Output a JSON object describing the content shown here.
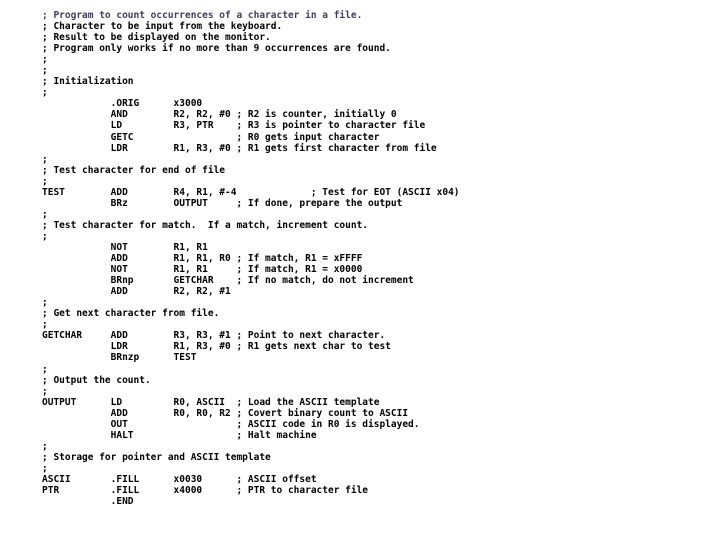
{
  "document": {
    "kind": "lc3-assembly-source-listing",
    "title": "Program to count occurrences of a character in a file.",
    "background_color": "#ffffff",
    "default_text_color": "#000000",
    "accent_text_color": "#3c3c64",
    "comment_char": ";",
    "columns": {
      "label": 0,
      "opcode": 12,
      "operand": 23,
      "comment": 35,
      "comment_far": 48
    }
  },
  "lines": [
    {
      "id": "l01",
      "text": "; Program to count occurrences of a character in a file.",
      "color": "accent"
    },
    {
      "id": "l02",
      "text": "; Character to be input from the keyboard."
    },
    {
      "id": "l03",
      "text": "; Result to be displayed on the monitor."
    },
    {
      "id": "l04",
      "text": "; Program only works if no more than 9 occurrences are found."
    },
    {
      "id": "l05",
      "text": ";"
    },
    {
      "id": "l06",
      "text": ";"
    },
    {
      "id": "l07",
      "text": "; Initialization"
    },
    {
      "id": "l08",
      "text": ";"
    },
    {
      "id": "l09",
      "text": "            .ORIG      x3000"
    },
    {
      "id": "l10",
      "text": "            AND        R2, R2, #0 ; R2 is counter, initially 0"
    },
    {
      "id": "l11",
      "text": "            LD         R3, PTR    ; R3 is pointer to character file"
    },
    {
      "id": "l12",
      "text": "            GETC                  ; R0 gets input character"
    },
    {
      "id": "l13",
      "text": "            LDR        R1, R3, #0 ; R1 gets first character from file"
    },
    {
      "id": "l14",
      "text": ";"
    },
    {
      "id": "l15",
      "text": "; Test character for end of file"
    },
    {
      "id": "l16",
      "text": ";"
    },
    {
      "id": "l17",
      "text": "TEST        ADD        R4, R1, #-4             ; Test for EOT (ASCII x04)"
    },
    {
      "id": "l18",
      "text": "            BRz        OUTPUT     ; If done, prepare the output"
    },
    {
      "id": "l19",
      "text": ";"
    },
    {
      "id": "l20",
      "text": "; Test character for match.  If a match, increment count."
    },
    {
      "id": "l21",
      "text": ";"
    },
    {
      "id": "l22",
      "text": "            NOT        R1, R1"
    },
    {
      "id": "l23",
      "text": "            ADD        R1, R1, R0 ; If match, R1 = xFFFF"
    },
    {
      "id": "l24",
      "text": "            NOT        R1, R1     ; If match, R1 = x0000"
    },
    {
      "id": "l25",
      "text": "            BRnp       GETCHAR    ; If no match, do not increment"
    },
    {
      "id": "l26",
      "text": "            ADD        R2, R2, #1"
    },
    {
      "id": "l27",
      "text": ";"
    },
    {
      "id": "l28",
      "text": "; Get next character from file."
    },
    {
      "id": "l29",
      "text": ";"
    },
    {
      "id": "l30",
      "text": "GETCHAR     ADD        R3, R3, #1 ; Point to next character."
    },
    {
      "id": "l31",
      "text": "            LDR        R1, R3, #0 ; R1 gets next char to test"
    },
    {
      "id": "l32",
      "text": "            BRnzp      TEST"
    },
    {
      "id": "l33",
      "text": ";"
    },
    {
      "id": "l34",
      "text": "; Output the count."
    },
    {
      "id": "l35",
      "text": ";"
    },
    {
      "id": "l36",
      "text": "OUTPUT      LD         R0, ASCII  ; Load the ASCII template"
    },
    {
      "id": "l37",
      "text": "            ADD        R0, R0, R2 ; Covert binary count to ASCII"
    },
    {
      "id": "l38",
      "text": "            OUT                   ; ASCII code in R0 is displayed."
    },
    {
      "id": "l39",
      "text": "            HALT                  ; Halt machine"
    },
    {
      "id": "l40",
      "text": ";"
    },
    {
      "id": "l41",
      "text": "; Storage for pointer and ASCII template"
    },
    {
      "id": "l42",
      "text": ";"
    },
    {
      "id": "l43",
      "text": "ASCII       .FILL      x0030      ; ASCII offset"
    },
    {
      "id": "l44",
      "text": "PTR         .FILL      x4000      ; PTR to character file"
    },
    {
      "id": "l45",
      "text": "            .END"
    }
  ]
}
